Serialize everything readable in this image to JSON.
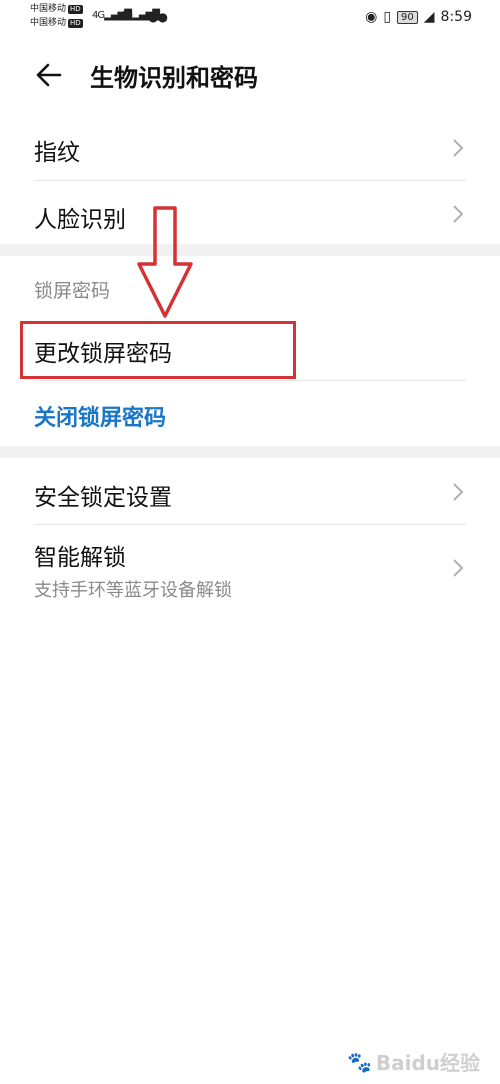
{
  "status_bar": {
    "carrier1": "中国移动",
    "carrier2": "中国移动",
    "hd": "HD",
    "net1": "4G",
    "net2": "4G",
    "battery": "90",
    "time": "8:59"
  },
  "header": {
    "title": "生物识别和密码"
  },
  "items": {
    "fingerprint": "指纹",
    "face": "人脸识别",
    "lock_section": "锁屏密码",
    "change_lock": "更改锁屏密码",
    "close_lock": "关闭锁屏密码",
    "security_lock": "安全锁定设置",
    "smart_unlock": "智能解锁",
    "smart_unlock_desc": "支持手环等蓝牙设备解锁"
  },
  "colors": {
    "link": "#1a76c9",
    "annotation": "#d43235"
  },
  "watermark": "Baidu经验"
}
